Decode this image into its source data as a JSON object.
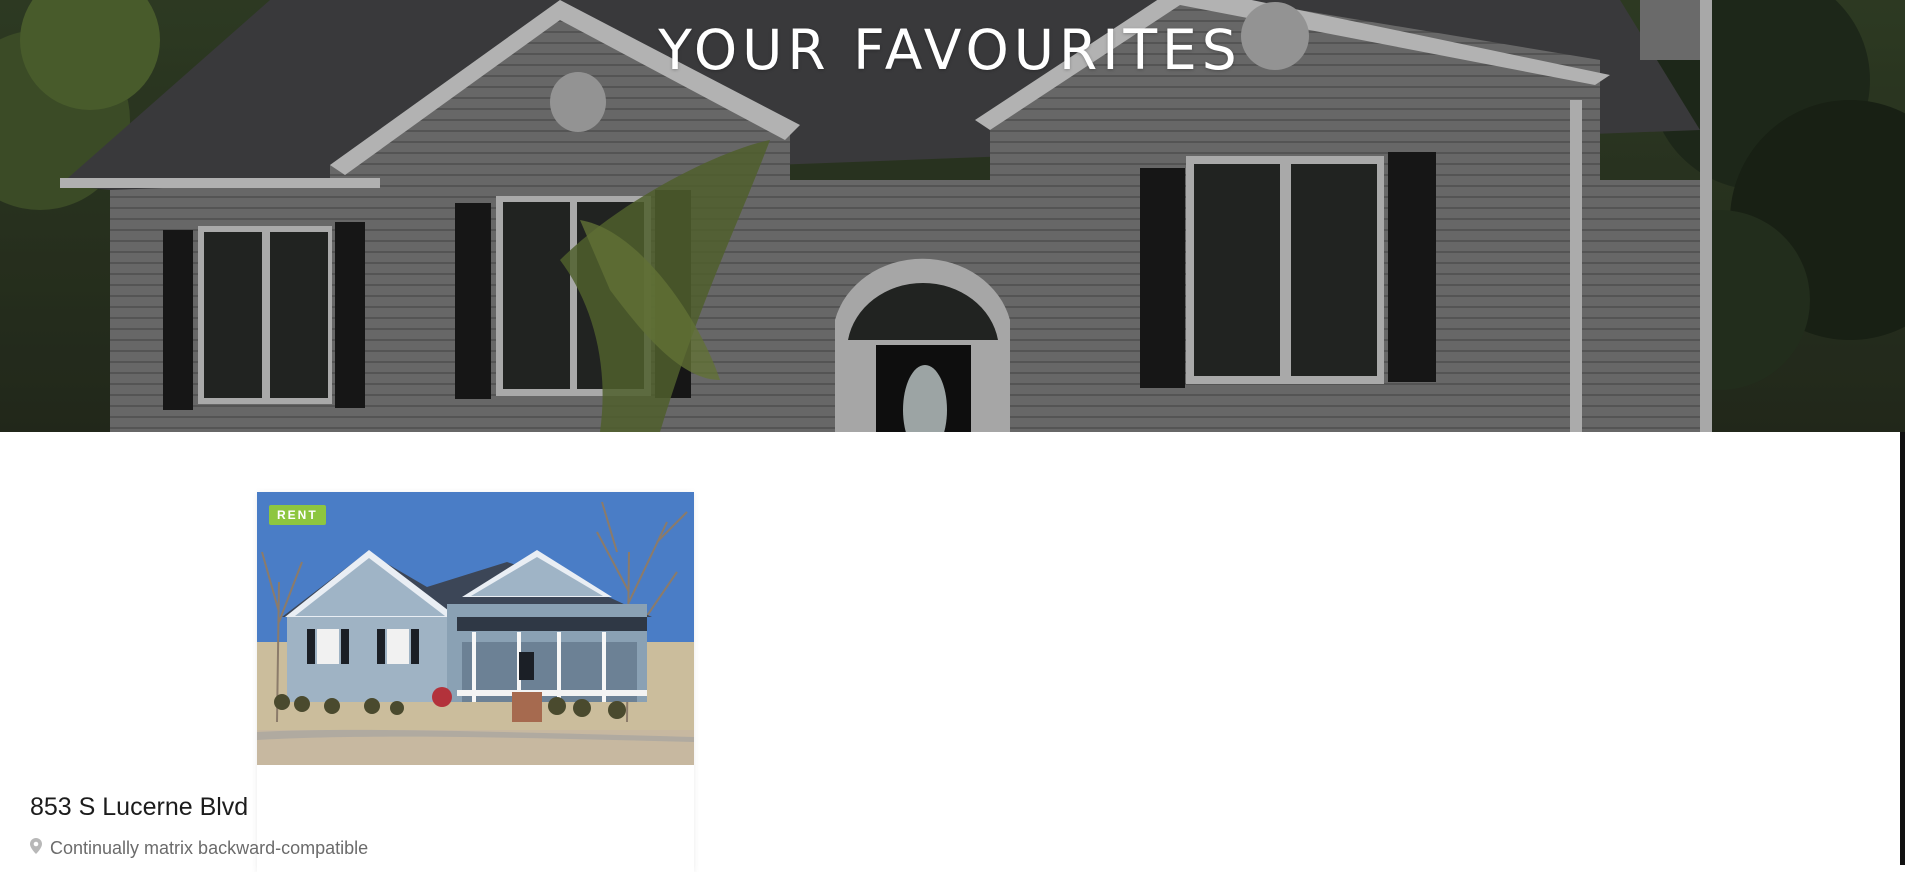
{
  "hero": {
    "title": "YOUR FAVOURITES"
  },
  "listings": [
    {
      "badge": "RENT",
      "title": "853 S Lucerne Blvd",
      "address": "Continually matrix backward-compatible",
      "address_icon": "map-pin-icon"
    }
  ],
  "colors": {
    "badge": "#8dc63f",
    "title": "#1c1c1c",
    "muted": "#6b6b6b"
  }
}
